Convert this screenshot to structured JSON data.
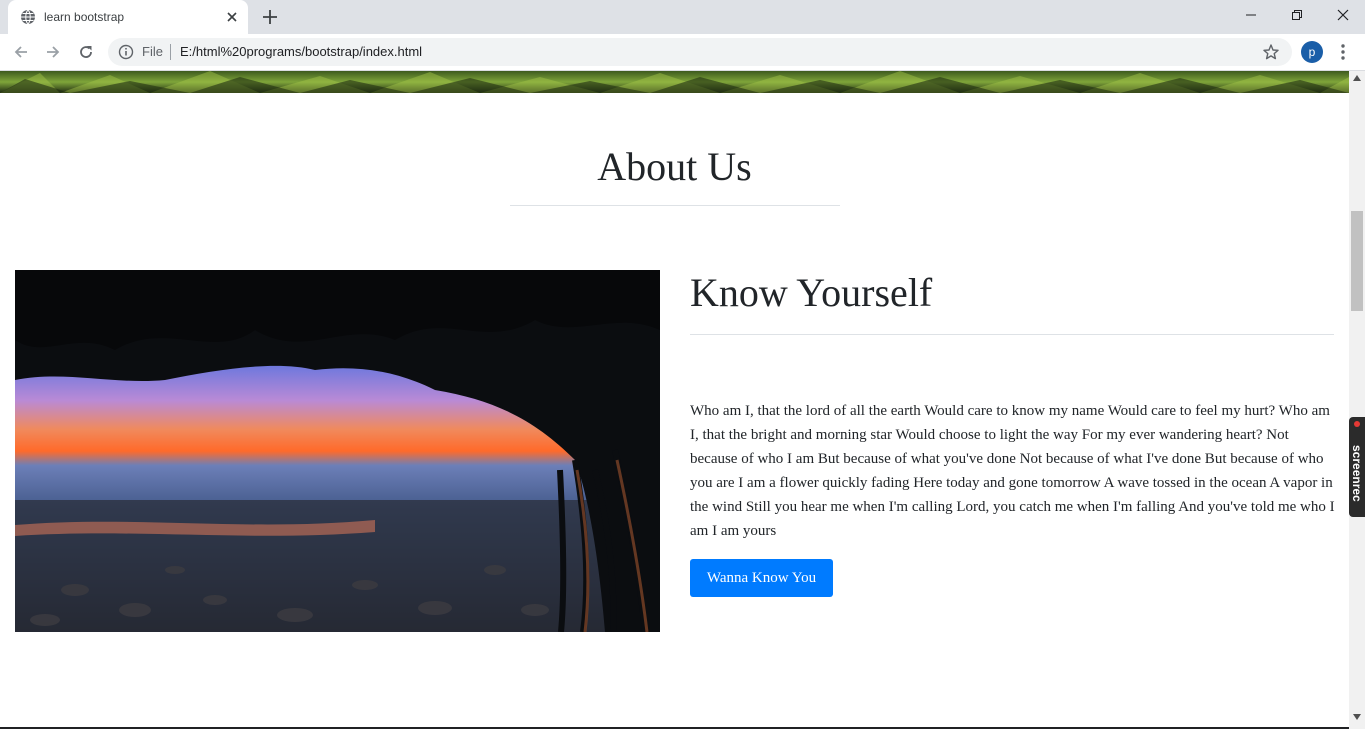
{
  "browser": {
    "tab_title": "learn bootstrap",
    "address_scheme_label": "File",
    "address_url": "E:/html%20programs/bootstrap/index.html",
    "profile_initial": "p",
    "accent_color": "#1a5ea8"
  },
  "page": {
    "section_title": "About Us",
    "feature": {
      "heading": "Know Yourself",
      "body": "Who am I, that the lord of all the earth Would care to know my name Would care to feel my hurt? Who am I, that the bright and morning star Would choose to light the way For my ever wandering heart? Not because of who I am But because of what you've done Not because of what I've done But because of who you are I am a flower quickly fading Here today and gone tomorrow A wave tossed in the ocean A vapor in the wind Still you hear me when I'm calling Lord, you catch me when I'm falling And you've told me who I am I am yours",
      "button_label": "Wanna Know You",
      "button_color": "#007bff"
    }
  },
  "overlay": {
    "screenrec_label": "screenrec"
  }
}
